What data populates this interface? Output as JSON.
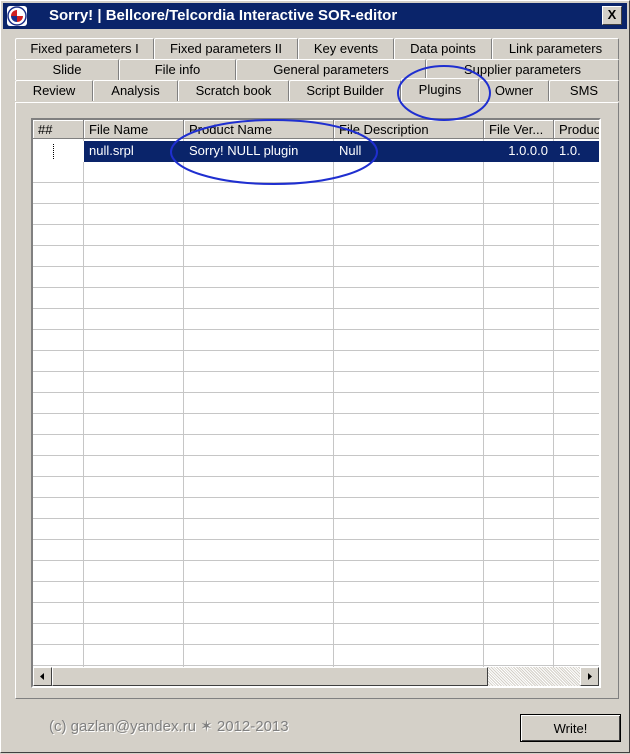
{
  "window": {
    "title": "Sorry!  |  Bellcore/Telcordia Interactive SOR-editor",
    "close_glyph": "X"
  },
  "tabs": {
    "row1": [
      "Fixed parameters I",
      "Fixed parameters II",
      "Key events",
      "Data points",
      "Link parameters"
    ],
    "row2": [
      "Slide",
      "File info",
      "General parameters",
      "Supplier parameters"
    ],
    "row3": [
      "Review",
      "Analysis",
      "Scratch book",
      "Script Builder",
      "Plugins",
      "Owner",
      "SMS"
    ],
    "active": "Plugins"
  },
  "grid": {
    "columns": [
      "##",
      "File  Name",
      "Product Name",
      "File Description",
      "File Ver...",
      "Produc"
    ],
    "rows": [
      [
        "",
        "null.srpl",
        "Sorry! NULL plugin",
        "Null",
        "1.0.0.0",
        "1.0."
      ]
    ]
  },
  "footer": {
    "copyright": "(c)  gazlan@yandex.ru  ✶  2012-2013"
  },
  "buttons": {
    "write_label": "Write!"
  },
  "colors": {
    "face": "#d4d0c8",
    "titlebar": "#0a246a",
    "selection": "#0a246a",
    "annotation": "#1f2fd0"
  }
}
